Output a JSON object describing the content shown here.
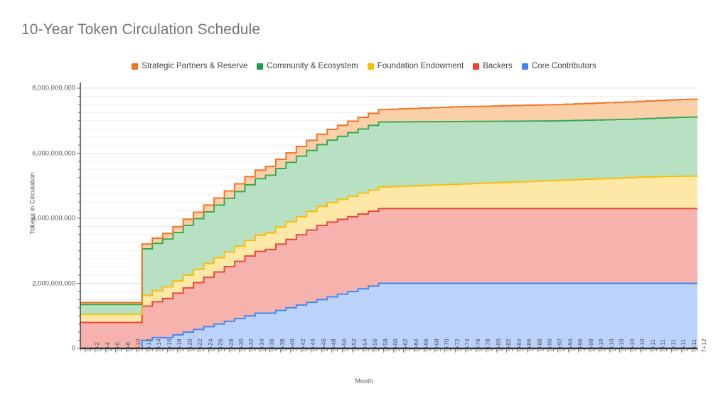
{
  "chart_data": {
    "type": "area",
    "title": "10-Year Token Circulation Schedule",
    "subtitle": "",
    "xlabel": "Month",
    "ylabel": "Tokens in Circulation",
    "stacked": true,
    "grid": true,
    "legend_position": "top",
    "xlim": [
      0,
      120
    ],
    "ylim": [
      0,
      8000000000
    ],
    "ytick_values": [
      0,
      2000000000,
      4000000000,
      6000000000,
      8000000000
    ],
    "ytick_labels": [
      "0",
      "2,000,000,000",
      "4,000,000,000",
      "6,000,000,000",
      "8,000,000,000"
    ],
    "x": [
      0,
      2,
      4,
      6,
      8,
      10,
      12,
      14,
      16,
      18,
      20,
      22,
      24,
      26,
      28,
      30,
      32,
      34,
      36,
      38,
      40,
      42,
      44,
      46,
      48,
      50,
      52,
      54,
      56,
      58,
      60,
      62,
      64,
      66,
      68,
      70,
      72,
      74,
      76,
      78,
      80,
      82,
      84,
      86,
      88,
      90,
      92,
      94,
      96,
      98,
      100,
      102,
      104,
      106,
      108,
      110,
      112,
      114,
      116,
      118,
      120
    ],
    "xtick_labels": [
      "T",
      "T+2",
      "T+4",
      "T+6",
      "T+8",
      "T+10",
      "T+12",
      "T+14",
      "T+16",
      "T+18",
      "T+20",
      "T+22",
      "T+24",
      "T+26",
      "T+28",
      "T+30",
      "T+32",
      "T+34",
      "T+36",
      "T+38",
      "T+40",
      "T+42",
      "T+44",
      "T+46",
      "T+48",
      "T+50",
      "T+52",
      "T+54",
      "T+56",
      "T+58",
      "T+60",
      "T+62",
      "T+64",
      "T+66",
      "T+68",
      "T+70",
      "T+72",
      "T+74",
      "T+76",
      "T+78",
      "T+80",
      "T+82",
      "T+84",
      "T+86",
      "T+88",
      "T+90",
      "T+92",
      "T+94",
      "T+96",
      "T+98",
      "T+10",
      "T+10",
      "T+10",
      "T+10",
      "T+10",
      "T+11",
      "T+11",
      "T+11",
      "T+11",
      "T+11",
      "T+12"
    ],
    "series": [
      {
        "name": "Core Contributors",
        "color": "#4285F4",
        "fill": "#BBD2FB",
        "values": [
          0,
          0,
          0,
          0,
          0,
          0,
          250000000,
          333000000,
          333000000,
          417000000,
          500000000,
          583000000,
          667000000,
          750000000,
          833000000,
          917000000,
          1000000000,
          1083000000,
          1083000000,
          1167000000,
          1250000000,
          1333000000,
          1417000000,
          1500000000,
          1583000000,
          1667000000,
          1750000000,
          1833000000,
          1917000000,
          2000000000,
          2000000000,
          2000000000,
          2000000000,
          2000000000,
          2000000000,
          2000000000,
          2000000000,
          2000000000,
          2000000000,
          2000000000,
          2000000000,
          2000000000,
          2000000000,
          2000000000,
          2000000000,
          2000000000,
          2000000000,
          2000000000,
          2000000000,
          2000000000,
          2000000000,
          2000000000,
          2000000000,
          2000000000,
          2000000000,
          2000000000,
          2000000000,
          2000000000,
          2000000000,
          2000000000,
          2000000000
        ]
      },
      {
        "name": "Backers",
        "color": "#EA4335",
        "fill": "#F6B3AE",
        "values": [
          800000000,
          800000000,
          800000000,
          800000000,
          800000000,
          800000000,
          1050000000,
          1100000000,
          1200000000,
          1280000000,
          1360000000,
          1440000000,
          1520000000,
          1600000000,
          1680000000,
          1760000000,
          1840000000,
          1900000000,
          1960000000,
          2040000000,
          2100000000,
          2160000000,
          2220000000,
          2280000000,
          2300000000,
          2300000000,
          2300000000,
          2300000000,
          2300000000,
          2300000000,
          2300000000,
          2300000000,
          2300000000,
          2300000000,
          2300000000,
          2300000000,
          2300000000,
          2300000000,
          2300000000,
          2300000000,
          2300000000,
          2300000000,
          2300000000,
          2300000000,
          2300000000,
          2300000000,
          2300000000,
          2300000000,
          2300000000,
          2300000000,
          2300000000,
          2300000000,
          2300000000,
          2300000000,
          2300000000,
          2300000000,
          2300000000,
          2300000000,
          2300000000,
          2300000000,
          2300000000
        ]
      },
      {
        "name": "Foundation Endowment",
        "color": "#FBBC04",
        "fill": "#FDE8A8",
        "values": [
          250000000,
          250000000,
          250000000,
          250000000,
          250000000,
          250000000,
          330000000,
          345000000,
          360000000,
          375000000,
          390000000,
          405000000,
          420000000,
          435000000,
          450000000,
          465000000,
          480000000,
          495000000,
          510000000,
          525000000,
          540000000,
          555000000,
          570000000,
          585000000,
          600000000,
          612000000,
          624000000,
          636000000,
          648000000,
          660000000,
          672000000,
          684000000,
          696000000,
          708000000,
          720000000,
          732000000,
          744000000,
          756000000,
          768000000,
          780000000,
          792000000,
          804000000,
          816000000,
          828000000,
          840000000,
          852000000,
          864000000,
          876000000,
          888000000,
          900000000,
          912000000,
          924000000,
          936000000,
          948000000,
          960000000,
          972000000,
          980000000,
          988000000,
          992000000,
          996000000,
          1000000000
        ]
      },
      {
        "name": "Community & Ecosystem",
        "color": "#34A853",
        "fill": "#B8E0C2",
        "values": [
          300000000,
          300000000,
          300000000,
          300000000,
          300000000,
          300000000,
          1430000000,
          1450000000,
          1470000000,
          1490000000,
          1530000000,
          1560000000,
          1590000000,
          1620000000,
          1650000000,
          1680000000,
          1710000000,
          1740000000,
          1770000000,
          1800000000,
          1830000000,
          1860000000,
          1880000000,
          1900000000,
          1920000000,
          1940000000,
          1960000000,
          1975000000,
          1990000000,
          2000000000,
          1990000000,
          1980000000,
          1970000000,
          1960000000,
          1950000000,
          1940000000,
          1930000000,
          1920000000,
          1910000000,
          1900000000,
          1890000000,
          1880000000,
          1870000000,
          1860000000,
          1850000000,
          1840000000,
          1830000000,
          1825000000,
          1820000000,
          1815000000,
          1810000000,
          1805000000,
          1800000000,
          1795000000,
          1795000000,
          1795000000,
          1800000000,
          1805000000,
          1810000000,
          1815000000,
          1820000000
        ]
      },
      {
        "name": "Strategic Partners & Reserve",
        "color": "#F37121",
        "fill": "#FBCFA8",
        "values": [
          60000000,
          60000000,
          60000000,
          60000000,
          60000000,
          60000000,
          150000000,
          160000000,
          170000000,
          180000000,
          190000000,
          200000000,
          210000000,
          220000000,
          230000000,
          240000000,
          250000000,
          260000000,
          270000000,
          280000000,
          290000000,
          300000000,
          310000000,
          320000000,
          330000000,
          340000000,
          350000000,
          360000000,
          370000000,
          380000000,
          390000000,
          400000000,
          410000000,
          420000000,
          430000000,
          440000000,
          450000000,
          455000000,
          460000000,
          465000000,
          470000000,
          475000000,
          480000000,
          485000000,
          490000000,
          495000000,
          500000000,
          505000000,
          510000000,
          515000000,
          520000000,
          525000000,
          530000000,
          535000000,
          538000000,
          540000000,
          542000000,
          544000000,
          546000000,
          548000000,
          550000000
        ]
      }
    ],
    "stack_totals_readout": {
      "at_T": 1410000000,
      "at_T_plus_12": 3210000000,
      "at_T_plus_48": 6733000000,
      "at_T_plus_120": 7670000000
    }
  },
  "legend": {
    "items": [
      {
        "label": "Strategic Partners & Reserve",
        "color": "#F37121"
      },
      {
        "label": "Community & Ecosystem",
        "color": "#1E9E4A"
      },
      {
        "label": "Foundation Endowment",
        "color": "#FBBC04"
      },
      {
        "label": "Backers",
        "color": "#EA4335"
      },
      {
        "label": "Core Contributors",
        "color": "#4285F4"
      }
    ]
  },
  "style": {
    "background": "#FFFFFF",
    "grid_color": "#E3E3E3",
    "axis_color": "#333333",
    "title_color": "#757575",
    "tick_color": "#555555"
  }
}
